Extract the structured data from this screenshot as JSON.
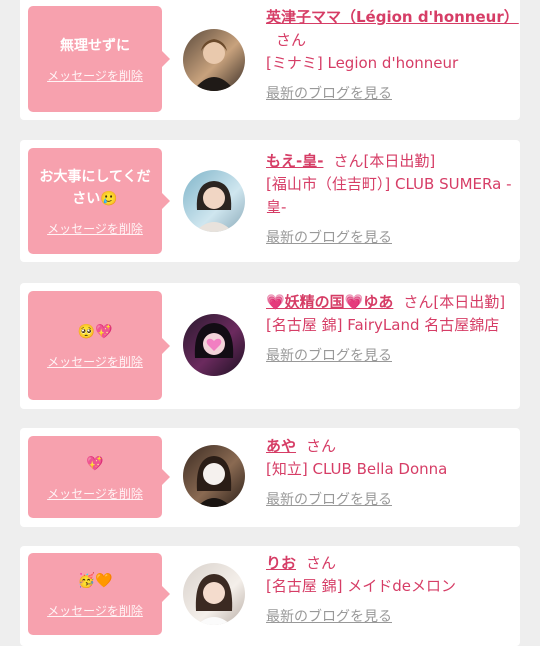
{
  "blog_link_label": "最新のブログを見る",
  "delete_label": "メッセージを削除",
  "honorific": "さん",
  "colors": {
    "accent": "#d63d66",
    "bubble": "#f7a1ae",
    "muted": "#999999",
    "background": "#eeeeee"
  },
  "entries": [
    {
      "message": "無理せずに",
      "name": "英津子ママ（Légion d'honneur）",
      "status": "",
      "shop": "[ミナミ] Legion d'honneur",
      "avatar_icon": "avatar-photo"
    },
    {
      "message": "お大事にしてください🥲",
      "name": "もえ-皇-",
      "status": "[本日出勤]",
      "shop": "[福山市（住吉町）] CLUB SUMERa -皇-",
      "avatar_icon": "avatar-photo"
    },
    {
      "message": "🥺💖",
      "name": "💗妖精の国💗ゆあ",
      "status": "[本日出勤]",
      "shop": "[名古屋 錦] FairyLand 名古屋錦店",
      "avatar_icon": "avatar-photo"
    },
    {
      "message": "💖",
      "name": "あや",
      "status": "",
      "shop": "[知立] CLUB Bella Donna",
      "avatar_icon": "avatar-photo"
    },
    {
      "message": "🥳🧡",
      "name": "りお",
      "status": "",
      "shop": "[名古屋 錦] メイドdeメロン",
      "avatar_icon": "avatar-photo"
    }
  ]
}
